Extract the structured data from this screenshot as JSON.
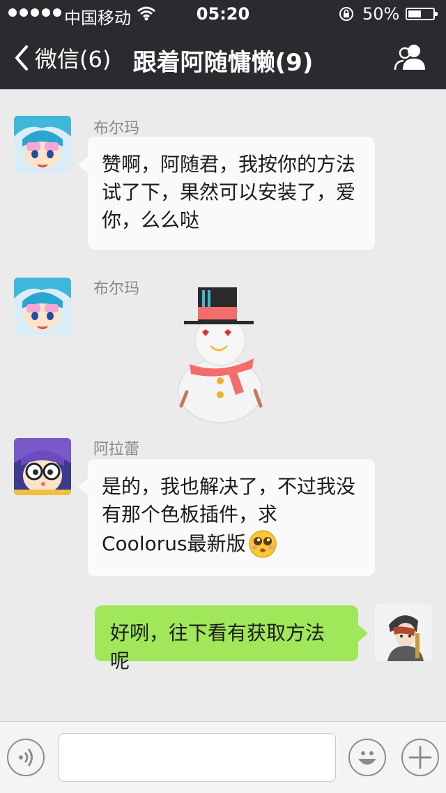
{
  "status": {
    "carrier": "中国移动",
    "time": "05:20",
    "battery": "50%"
  },
  "nav": {
    "back_label": "微信(6)",
    "title": "跟着阿随慵懒(9)"
  },
  "messages": [
    {
      "sender": "布尔玛",
      "side": "left",
      "text_lines": [
        "赞啊，阿随君，我按你的方法",
        "试了下，果然可以安装了，爱",
        "你，么么哒"
      ]
    },
    {
      "sender": "布尔玛",
      "side": "left",
      "type": "sticker",
      "sticker": "snowman-sticker"
    },
    {
      "sender": "阿拉蕾",
      "side": "left",
      "text_lines": [
        "是的，我也解决了，不过我没",
        "有那个色板插件，求",
        "Coolorus最新版"
      ]
    },
    {
      "side": "right",
      "text": "好咧，往下看有获取方法呢"
    }
  ],
  "input": {
    "value": "",
    "placeholder": ""
  },
  "colors": {
    "topbar": "#2b2b2f",
    "background": "#ebebeb",
    "sent_bubble": "#a0e75a",
    "received_bubble": "#fafafa"
  }
}
